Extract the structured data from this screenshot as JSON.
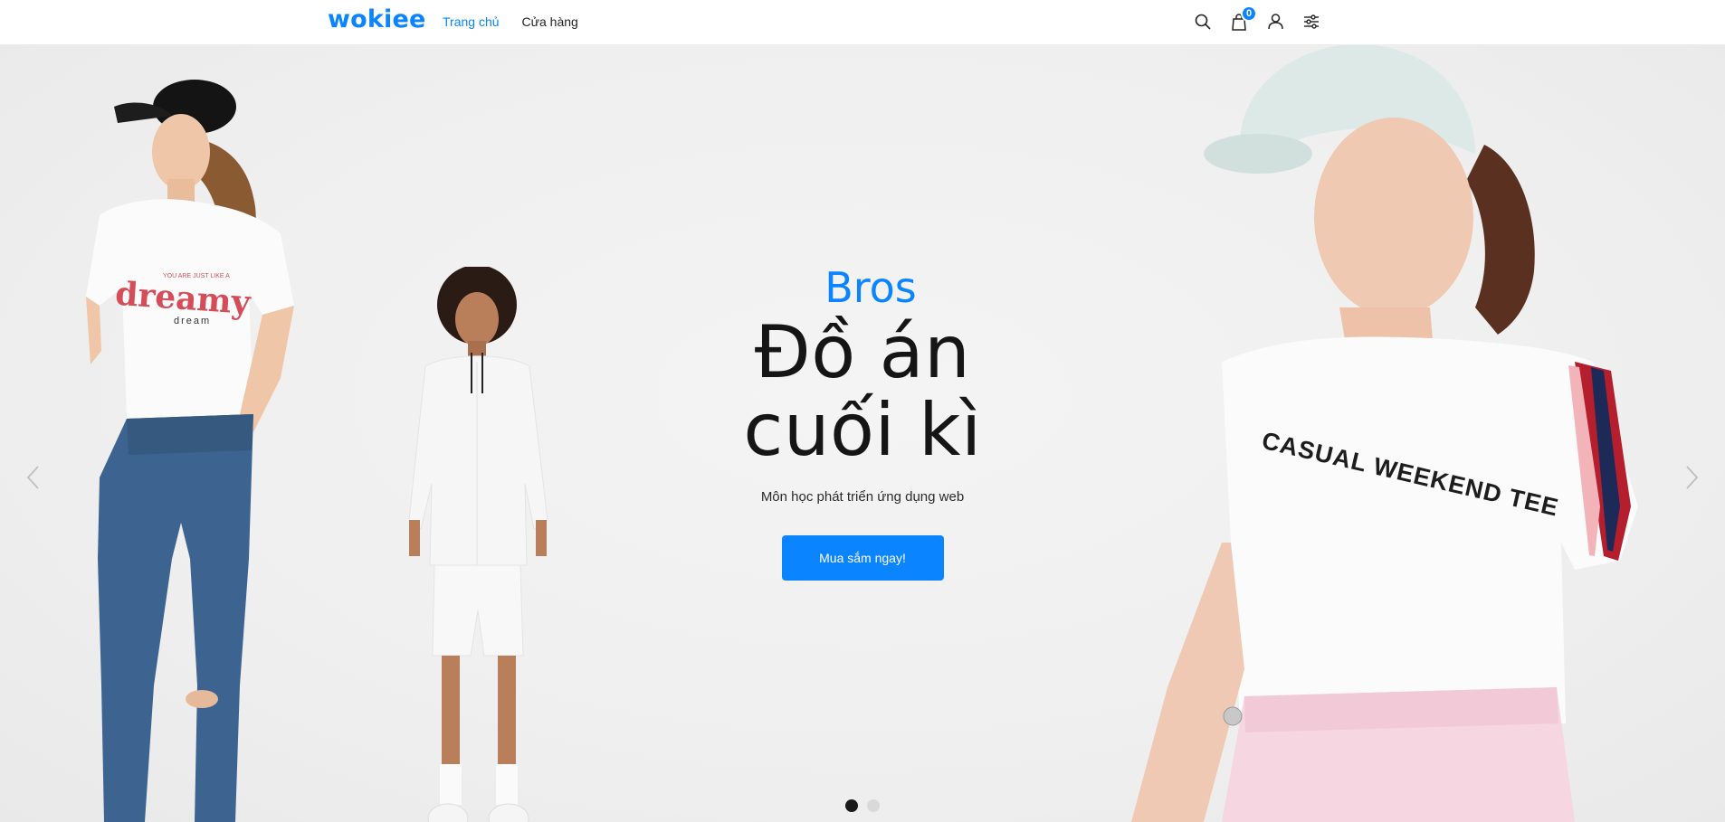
{
  "header": {
    "logo": "wokiee",
    "nav": [
      {
        "label": "Trang chủ",
        "active": true
      },
      {
        "label": "Cửa hàng",
        "active": false
      }
    ],
    "icons": [
      "search-icon",
      "shopping-bag-icon",
      "user-icon",
      "settings-sliders-icon"
    ],
    "cart_count": "0"
  },
  "hero": {
    "eyebrow": "Bros",
    "title_line1": "Đồ án",
    "title_line2": "cuối kì",
    "subtitle": "Môn học phát triển ứng dụng web",
    "cta_label": "Mua sắm ngay!",
    "slides": 2,
    "active_slide": 1,
    "left_shirt_text_small": "YOU ARE JUST LIKE A",
    "left_shirt_text_big": "dreamy",
    "left_shirt_text_tail": "dream",
    "right_shirt_text": "CASUAL WEEKEND TEE"
  },
  "colors": {
    "accent": "#0a84ff",
    "text_dark": "#151515",
    "background": "#efefef"
  }
}
